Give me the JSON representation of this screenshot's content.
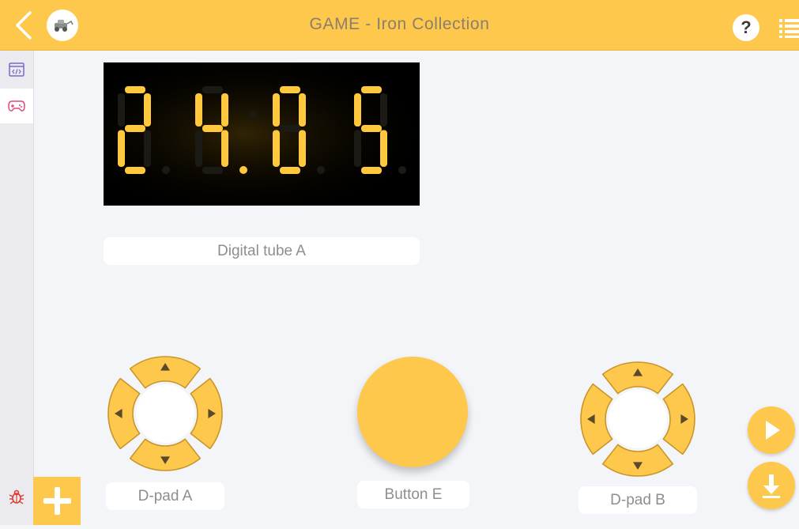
{
  "header": {
    "title": "GAME - Iron Collection",
    "help_label": "?",
    "back_icon": "chevron-left-icon",
    "list_icon": "list-icon"
  },
  "sidebar": {
    "items": [
      {
        "icon": "code-window-icon",
        "active": false
      },
      {
        "icon": "gamepad-icon",
        "active": true
      }
    ],
    "debug_icon": "bug-icon"
  },
  "widgets": {
    "digital_tube": {
      "label": "Digital tube A",
      "display": "24:05"
    },
    "dpad_a": {
      "label": "D-pad A"
    },
    "button_e": {
      "label": "Button E"
    },
    "dpad_b": {
      "label": "D-pad B"
    }
  },
  "actions": {
    "add_icon": "plus-icon",
    "run_icon": "play-icon",
    "download_icon": "download-icon"
  },
  "colors": {
    "accent": "#fdc84b",
    "segment_on": "#ffc83d",
    "background": "#f4f5f9"
  }
}
